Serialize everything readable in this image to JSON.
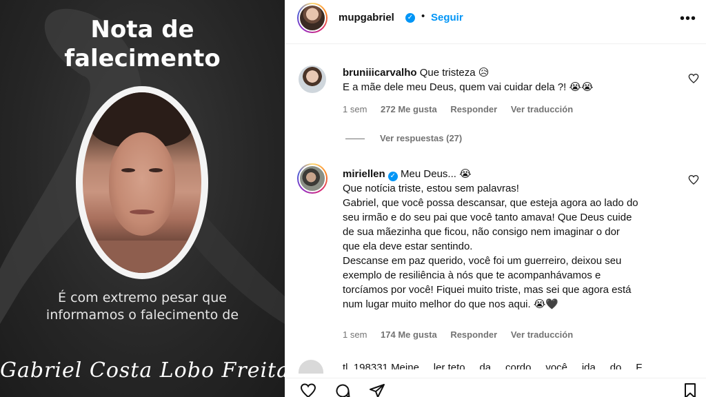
{
  "post": {
    "title": "Nota de falecimento",
    "title_line1": "Nota de",
    "title_line2": "falecimento",
    "notice_line1": "É com extremo pesar que",
    "notice_line2": "informamos o falecimento de",
    "signature": "Gabriel Costa Lobo Freitas"
  },
  "header": {
    "username": "mupgabriel",
    "separator": "•",
    "follow_label": "Seguir",
    "more_icon": "more-horizontal-icon"
  },
  "comments": [
    {
      "username": "bruniiicarvalho",
      "lines": [
        "Que tristeza 😥",
        "E a mãe dele meu Deus, quem vai cuidar dela ?! 😭😭"
      ],
      "time": "1 sem",
      "likes": "272 Me gusta",
      "reply": "Responder",
      "translate": "Ver traducción",
      "view_replies": "Ver respuestas (27)"
    },
    {
      "username": "miriellen",
      "verified": true,
      "lines": [
        "Meu Deus... 😭",
        "Que notícia triste, estou sem palavras!",
        "Gabriel, que você possa descansar, que esteja agora ao lado do",
        "seu irmão e do seu pai que você tanto amava! Que Deus cuide",
        "de sua mãezinha que ficou, não consigo nem imaginar o dor",
        "que ela deve estar sentindo.",
        "Descanse em paz querido, você foi um guerreiro, deixou seu",
        "exemplo de resiliência à nós que te acompanhávamos e",
        "torcíamos por você! Fiquei muito triste, mas sei que agora está",
        "num lugar muito melhor do que nos aqui. 😭🖤"
      ],
      "time": "1 sem",
      "likes": "174 Me gusta",
      "reply": "Responder",
      "translate": "Ver traducción"
    }
  ],
  "peek_comment": "tl_198331 Meine ... ler teto ... da ... cordo ... você ... ida ... do ... F",
  "colors": {
    "accent": "#0095f6",
    "muted": "#737373",
    "post_bg": "#2b2b2b"
  }
}
